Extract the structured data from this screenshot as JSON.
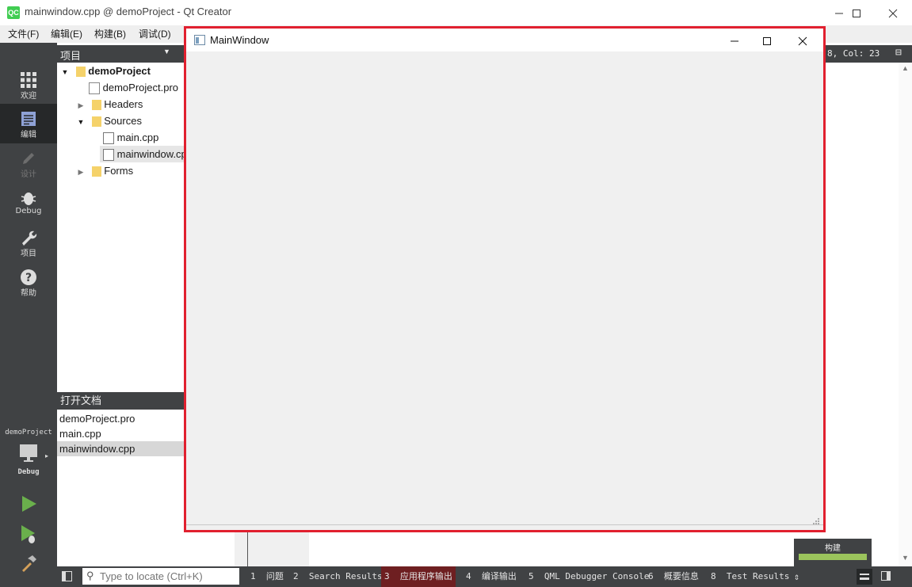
{
  "window": {
    "title": "mainwindow.cpp @ demoProject - Qt Creator",
    "logo": "QC"
  },
  "menu": [
    "文件(F)",
    "编辑(E)",
    "构建(B)",
    "调试(D)"
  ],
  "modes": [
    {
      "label": "欢迎",
      "icon": "grid-icon"
    },
    {
      "label": "编辑",
      "icon": "edit-doc-icon"
    },
    {
      "label": "设计",
      "icon": "pencil-icon"
    },
    {
      "label": "Debug",
      "icon": "bug-icon"
    },
    {
      "label": "项目",
      "icon": "wrench-icon"
    },
    {
      "label": "帮助",
      "icon": "help-icon"
    }
  ],
  "kit": {
    "project": "demoProject",
    "config": "Debug"
  },
  "project_panel": {
    "header": "项目",
    "tree": [
      {
        "label": "demoProject"
      },
      {
        "label": "demoProject.pro"
      },
      {
        "label": "Headers"
      },
      {
        "label": "Sources"
      },
      {
        "label": "main.cpp"
      },
      {
        "label": "mainwindow.cpp"
      },
      {
        "label": "Forms"
      }
    ]
  },
  "open_docs": {
    "header": "打开文档",
    "items": [
      "demoProject.pro",
      "main.cpp",
      "mainwindow.cpp"
    ]
  },
  "editor": {
    "cursor": "8, Col: 23"
  },
  "locator": {
    "placeholder": "Type to locate (Ctrl+K)"
  },
  "status_tabs": [
    {
      "num": "1",
      "label": "问题"
    },
    {
      "num": "2",
      "label": "Search Results"
    },
    {
      "num": "3",
      "label": "应用程序输出"
    },
    {
      "num": "4",
      "label": "编译输出"
    },
    {
      "num": "5",
      "label": "QML Debugger Console"
    },
    {
      "num": "6",
      "label": "概要信息"
    },
    {
      "num": "8",
      "label": "Test Results"
    }
  ],
  "build": {
    "label": "构建",
    "progress": 1.0
  },
  "main_window": {
    "title": "MainWindow"
  },
  "colors": {
    "accent_red": "#e1202f",
    "modebar": "#404244",
    "build_green": "#9bc45c",
    "active_tab": "#6e1f21"
  }
}
